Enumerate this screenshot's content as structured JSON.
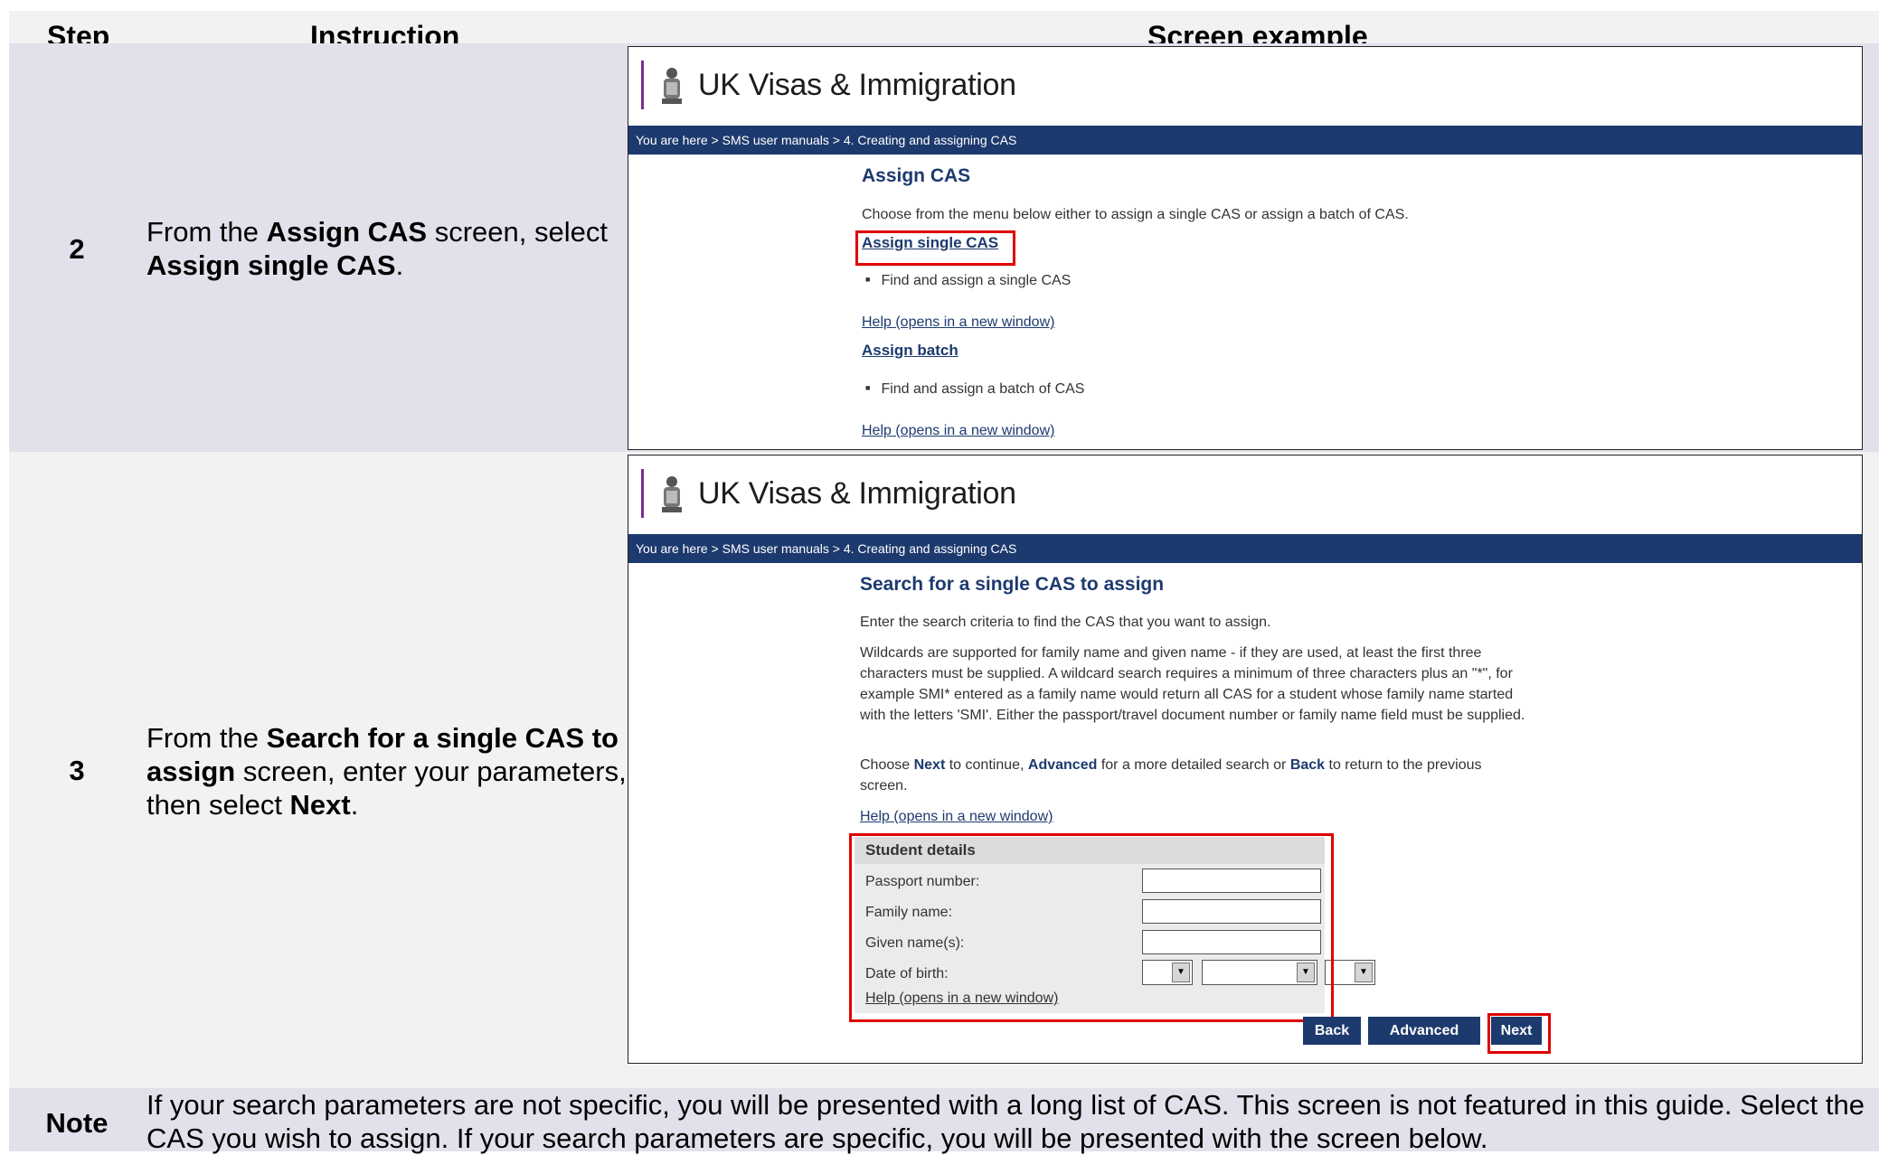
{
  "headers": {
    "step": "Step",
    "instruction": "Instruction",
    "screen": "Screen example"
  },
  "rows": [
    {
      "step": "2",
      "instruction": {
        "pre": "From the ",
        "b1": "Assign CAS",
        "mid": " screen, select ",
        "b2": "Assign single CAS",
        "post": "."
      },
      "screen": {
        "logo_text": "UK Visas & Immigration",
        "breadcrumb": "You are here > SMS user manuals >  4. Creating and assigning CAS",
        "title": "Assign CAS",
        "intro": "Choose from the menu below either to assign a single CAS or assign a batch of CAS.",
        "link_single": "Assign single CAS",
        "bullet_single": "Find and assign a single CAS",
        "help1": "Help (opens in a new window)",
        "link_batch": "Assign batch",
        "bullet_batch": "Find and assign a batch of CAS",
        "help2": "Help (opens in a new window)"
      }
    },
    {
      "step": "3",
      "instruction": {
        "pre": "From the ",
        "b1": "Search for a single CAS to assign",
        "mid": " screen, enter your parameters, then select ",
        "b2": "Next",
        "post": "."
      },
      "screen": {
        "logo_text": "UK Visas & Immigration",
        "breadcrumb": "You are here > SMS user manuals >  4. Creating and assigning CAS",
        "title": "Search for a single CAS to assign",
        "p1": "Enter the search criteria to find the CAS that you want to assign.",
        "p2": "Wildcards are supported for family name and given name - if they are used, at least the first three characters must be supplied. A wildcard search requires a minimum of three characters plus an \"*\", for example SMI* entered as a family name would return all CAS for a student whose family name started with the letters 'SMI'. Either the passport/travel document number or family name field must be supplied.",
        "p3": {
          "a": "Choose ",
          "next": "Next",
          "b": " to continue, ",
          "adv": "Advanced",
          "c": " for a more detailed search or ",
          "back": "Back",
          "d": " to return to the previous screen."
        },
        "help": "Help (opens in a new window)",
        "form_title": "Student details",
        "fields": [
          "Passport number:",
          "Family name:",
          "Given name(s):",
          "Date of birth:"
        ],
        "form_help": "Help (opens in a new window)",
        "buttons": {
          "back": "Back",
          "advanced": "Advanced",
          "next": "Next"
        }
      }
    }
  ],
  "note": {
    "label": "Note",
    "text": "If your search parameters are not specific, you will be presented with a long list of CAS. This screen is not featured in this guide. Select the CAS you wish to assign. If your search parameters are specific, you will be presented with the screen below."
  }
}
